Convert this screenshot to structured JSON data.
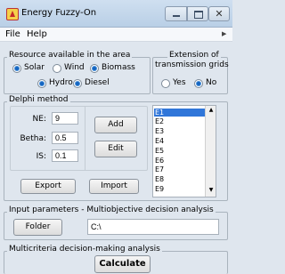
{
  "window": {
    "title": "Energy Fuzzy-On",
    "close_glyph": "✕"
  },
  "menu": {
    "file": "File",
    "help": "Help"
  },
  "resource": {
    "title": "Resource available in the area",
    "options": [
      {
        "label": "Solar",
        "selected": true
      },
      {
        "label": "Wind",
        "selected": false
      },
      {
        "label": "Biomass",
        "selected": true
      },
      {
        "label": "Hydro",
        "selected": true
      },
      {
        "label": "Diesel",
        "selected": true
      }
    ]
  },
  "extension": {
    "title_line1": "Extension of",
    "title_line2": "transmission grids",
    "options": [
      {
        "label": "Yes",
        "selected": false
      },
      {
        "label": "No",
        "selected": true
      }
    ]
  },
  "delphi": {
    "title": "Delphi method",
    "ne_label": "NE:",
    "ne_value": "9",
    "betha_label": "Betha:",
    "betha_value": "0.5",
    "is_label": "IS:",
    "is_value": "0.1",
    "add_button": "Add",
    "edit_button": "Edit",
    "export_button": "Export",
    "import_button": "Import",
    "list_items": [
      "E1",
      "E2",
      "E3",
      "E4",
      "E5",
      "E6",
      "E7",
      "E8",
      "E9"
    ],
    "selected_index": 0,
    "scroll_up": "▲",
    "scroll_down": "▼"
  },
  "input_params": {
    "title": "Input parameters - Multiobjective decision analysis",
    "folder_button": "Folder",
    "path_value": "C:\\"
  },
  "mcda": {
    "title": "Multicriteria decision-making analysis",
    "calculate_button": "Calculate"
  },
  "colors": {
    "selection": "#3076d9",
    "titlebar": "#c4d7ec"
  }
}
